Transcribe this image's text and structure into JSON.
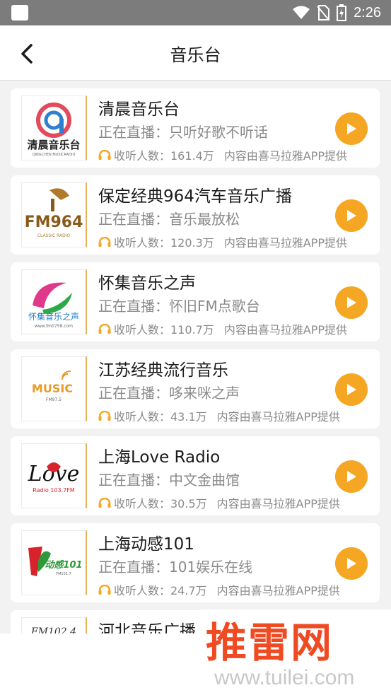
{
  "status_bar": {
    "time": "2:26",
    "icons": [
      "wifi-icon",
      "no-sim-icon",
      "battery-charging-icon"
    ]
  },
  "header": {
    "back_icon": "chevron-left-icon",
    "title": "音乐台"
  },
  "stations": [
    {
      "name": "清晨音乐台",
      "live": "正在直播：只听好歌不听话",
      "listeners": "收听人数：161.4万",
      "source": "内容由喜马拉雅APP提供",
      "logo_text": "清晨音乐台",
      "logo_subtext": "QINGCHEN MUSICRADIO",
      "accent": "#e34a5c"
    },
    {
      "name": "保定经典964汽车音乐广播",
      "live": "正在直播：音乐最放松",
      "listeners": "收听人数：120.3万",
      "source": "内容由喜马拉雅APP提供",
      "logo_text": "FM964",
      "logo_subtext": "CLASSIC RADIO",
      "accent": "#a8772a"
    },
    {
      "name": "怀集音乐之声",
      "live": "正在直播：怀旧FM点歌台",
      "listeners": "收听人数：110.7万",
      "source": "内容由喜马拉雅APP提供",
      "logo_text": "怀集音乐之声",
      "logo_subtext": "www.fm0758.com",
      "accent": "#1e7fc2"
    },
    {
      "name": "江苏经典流行音乐",
      "live": "正在直播：哆来咪之声",
      "listeners": "收听人数：43.1万",
      "source": "内容由喜马拉雅APP提供",
      "logo_text": "MUSIC",
      "logo_subtext": "FM97.5",
      "accent": "#e89a2a"
    },
    {
      "name": "上海Love Radio",
      "live": "正在直播：中文金曲馆",
      "listeners": "收听人数：30.5万",
      "source": "内容由喜马拉雅APP提供",
      "logo_text": "Love",
      "logo_subtext": "Radio 103.7FM",
      "accent": "#d8232a"
    },
    {
      "name": "上海动感101",
      "live": "正在直播：101娱乐在线",
      "listeners": "收听人数：24.7万",
      "source": "内容由喜马拉雅APP提供",
      "logo_text": "动感101",
      "logo_subtext": "FM101.7",
      "accent": "#2f9a3a"
    },
    {
      "name": "河北音乐广播",
      "live": "",
      "listeners": "",
      "source": "",
      "logo_text": "FM102.4",
      "logo_subtext": "",
      "accent": "#333333"
    }
  ],
  "watermark": {
    "brand": "推雷网",
    "url": "www.tuilei.com"
  },
  "colors": {
    "accent": "#f5a623",
    "status_bar": "#7c7c7c"
  }
}
